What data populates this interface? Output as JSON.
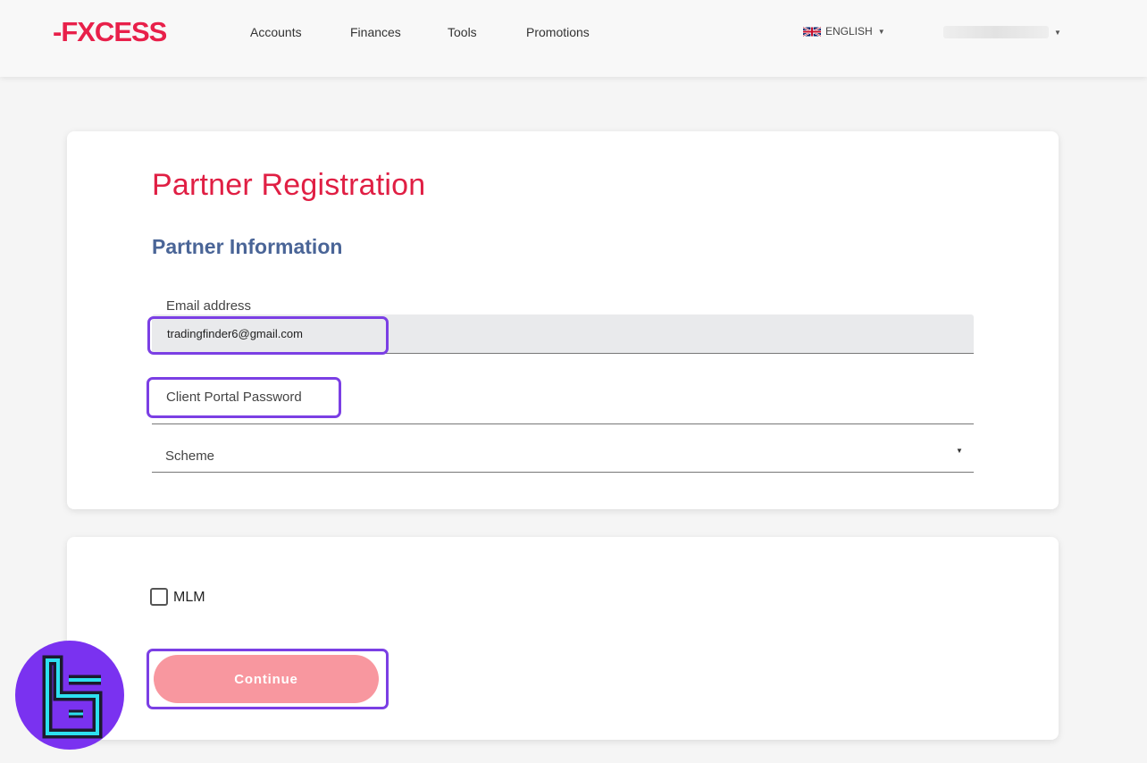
{
  "header": {
    "logo_text": "-FXCESS",
    "nav": [
      {
        "label": "Accounts"
      },
      {
        "label": "Finances"
      },
      {
        "label": "Tools"
      },
      {
        "label": "Promotions"
      }
    ],
    "language": {
      "label": "ENGLISH",
      "flag_icon": "uk-flag-icon"
    },
    "user_menu": {
      "icon": "chevron-down-icon"
    }
  },
  "form": {
    "title": "Partner Registration",
    "section_title": "Partner Information",
    "email": {
      "label": "Email address",
      "value": "tradingfinder6@gmail.com"
    },
    "password": {
      "label": "Client Portal Password"
    },
    "scheme": {
      "label": "Scheme",
      "icon": "dropdown-caret-icon"
    }
  },
  "options": {
    "mlm": {
      "label": "MLM",
      "checked": false
    }
  },
  "actions": {
    "continue_label": "Continue"
  },
  "colors": {
    "brand_red": "#e01f44",
    "section_blue": "#4a6597",
    "continue_pink": "#f8979f",
    "highlight_purple": "#7b3fe4"
  }
}
